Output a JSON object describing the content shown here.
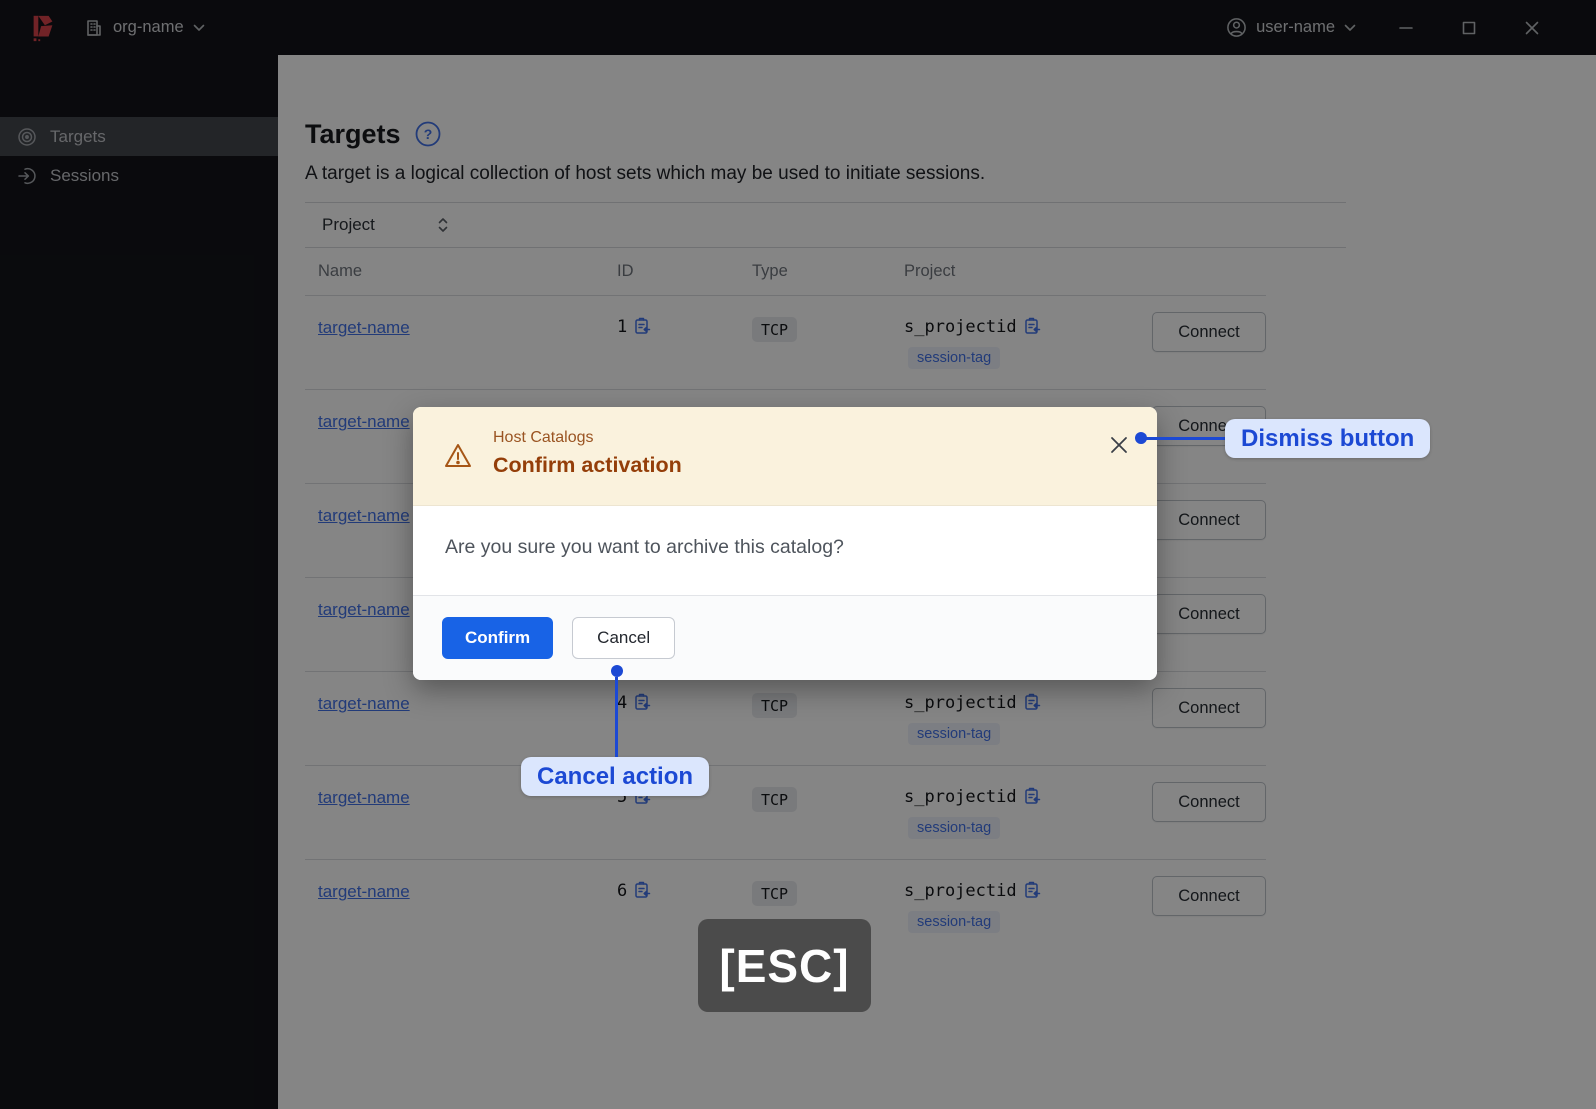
{
  "colors": {
    "accent_blue": "#4272e8",
    "annotation_blue": "#1c49d4",
    "annotation_bg": "#dbe6fd",
    "primary_button_bg": "#1863e6",
    "warning_bg": "#faf2dd",
    "warning_title": "#943e09",
    "warning_tagline": "#9a5422",
    "warning_icon": "#a65616",
    "brand_red": "#d8434b",
    "esc_bg": "#4b4b4b"
  },
  "icons": {
    "help_glyph": "?"
  },
  "topbar": {
    "org_name": "org-name",
    "user_name": "user-name"
  },
  "sidebar": {
    "items": [
      {
        "label": "Targets",
        "icon": "target-icon",
        "active": true
      },
      {
        "label": "Sessions",
        "icon": "sessions-icon",
        "active": false
      }
    ]
  },
  "page": {
    "title": "Targets",
    "description": "A target is a logical collection of host sets which may be used to initiate sessions."
  },
  "filter": {
    "label": "Project"
  },
  "table": {
    "headers": {
      "name": "Name",
      "id": "ID",
      "type": "Type",
      "project": "Project"
    },
    "rows": [
      {
        "name": "target-name",
        "id": "1",
        "type": "TCP",
        "project": "s_projectid",
        "tag": "session-tag",
        "action": "Connect"
      },
      {
        "name": "target-name",
        "id": "",
        "type": "",
        "project": "",
        "tag": "",
        "action": "Connect"
      },
      {
        "name": "target-name",
        "id": "",
        "type": "",
        "project": "",
        "tag": "",
        "action": "Connect"
      },
      {
        "name": "target-name",
        "id": "",
        "type": "",
        "project": "",
        "tag": "",
        "action": "Connect"
      },
      {
        "name": "target-name",
        "id": "4",
        "type": "TCP",
        "project": "s_projectid",
        "tag": "session-tag",
        "action": "Connect"
      },
      {
        "name": "target-name",
        "id": "5",
        "type": "TCP",
        "project": "s_projectid",
        "tag": "session-tag",
        "action": "Connect"
      },
      {
        "name": "target-name",
        "id": "6",
        "type": "TCP",
        "project": "s_projectid",
        "tag": "session-tag",
        "action": "Connect"
      }
    ]
  },
  "modal": {
    "tagline": "Host Catalogs",
    "title": "Confirm activation",
    "message": "Are you sure you want to archive this catalog?",
    "confirm_label": "Confirm",
    "cancel_label": "Cancel"
  },
  "annotations": {
    "dismiss_label": "Dismiss button",
    "cancel_label": "Cancel action",
    "key_label": "[ESC]"
  }
}
